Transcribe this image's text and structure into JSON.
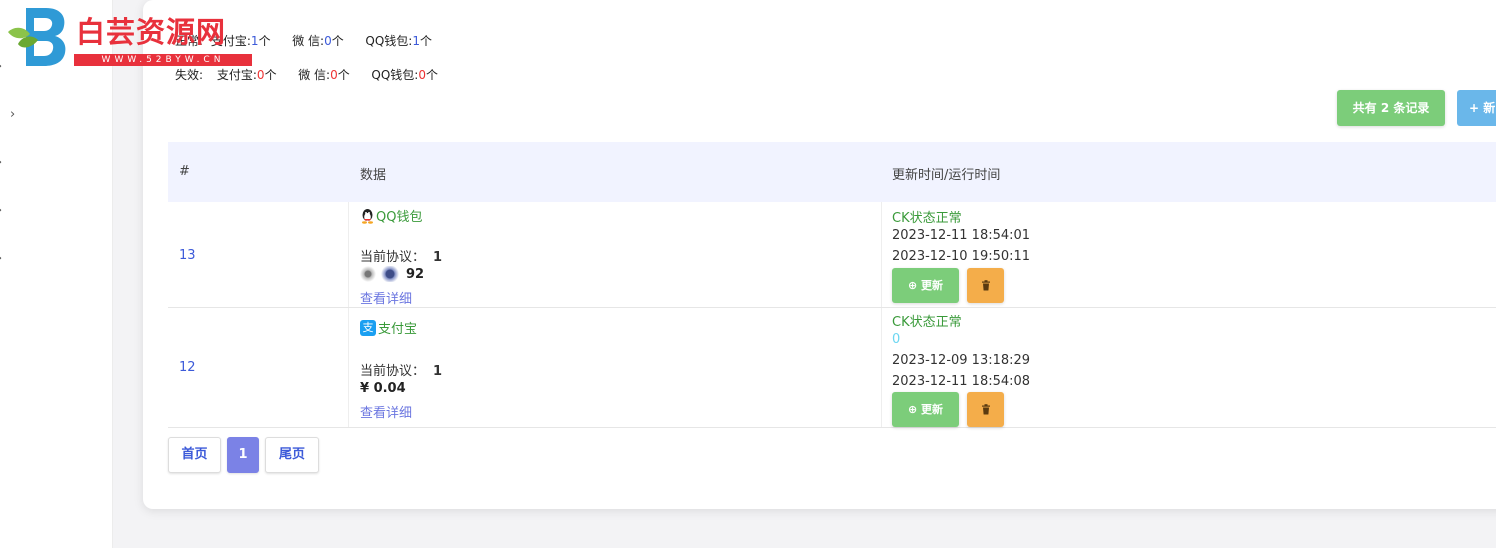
{
  "logo": {
    "title": "白芸资源网",
    "url": "WWW.52BYW.CN"
  },
  "stats": {
    "normal": {
      "label": "正常:",
      "alipay_label": "支付宝:",
      "alipay_count": "1",
      "wechat_label": "微 信:",
      "wechat_count": "0",
      "qq_label": "QQ钱包:",
      "qq_count": "1",
      "unit": "个"
    },
    "invalid": {
      "label": "失效:",
      "alipay_label": "支付宝:",
      "alipay_count": "0",
      "wechat_label": "微 信:",
      "wechat_count": "0",
      "qq_label": "QQ钱包:",
      "qq_count": "0",
      "unit": "个"
    }
  },
  "toolbar": {
    "total_label": "共有 2 条记录",
    "new_label": "+ 新"
  },
  "table": {
    "headers": [
      "#",
      "数据",
      "更新时间/运行时间"
    ],
    "rows": [
      {
        "id": "13",
        "type": "QQ钱包",
        "type_icon": "qq-penguin-icon",
        "protocol_label": "当前协议：",
        "protocol": "1",
        "amount": "92",
        "detail": "查看详细",
        "status": "CK状态正常",
        "time1": "2023-12-11 18:54:01",
        "time2": "2023-12-10 19:50:11",
        "update_label": "更新"
      },
      {
        "id": "12",
        "type": "支付宝",
        "type_icon": "alipay-icon",
        "protocol_label": "当前协议：",
        "protocol": "1",
        "amount": "¥ 0.04",
        "detail": "查看详细",
        "status": "CK状态正常",
        "zero": "0",
        "time1": "2023-12-09 13:18:29",
        "time2": "2023-12-11 18:54:08",
        "update_label": "更新"
      }
    ]
  },
  "pagination": {
    "first": "首页",
    "current": "1",
    "last": "尾页"
  },
  "colors": {
    "green": "#7ccd7a",
    "blue": "#6ab7ea",
    "orange": "#f4ad4a",
    "link": "#3c5ad9",
    "pager_active": "#7b82e6"
  }
}
